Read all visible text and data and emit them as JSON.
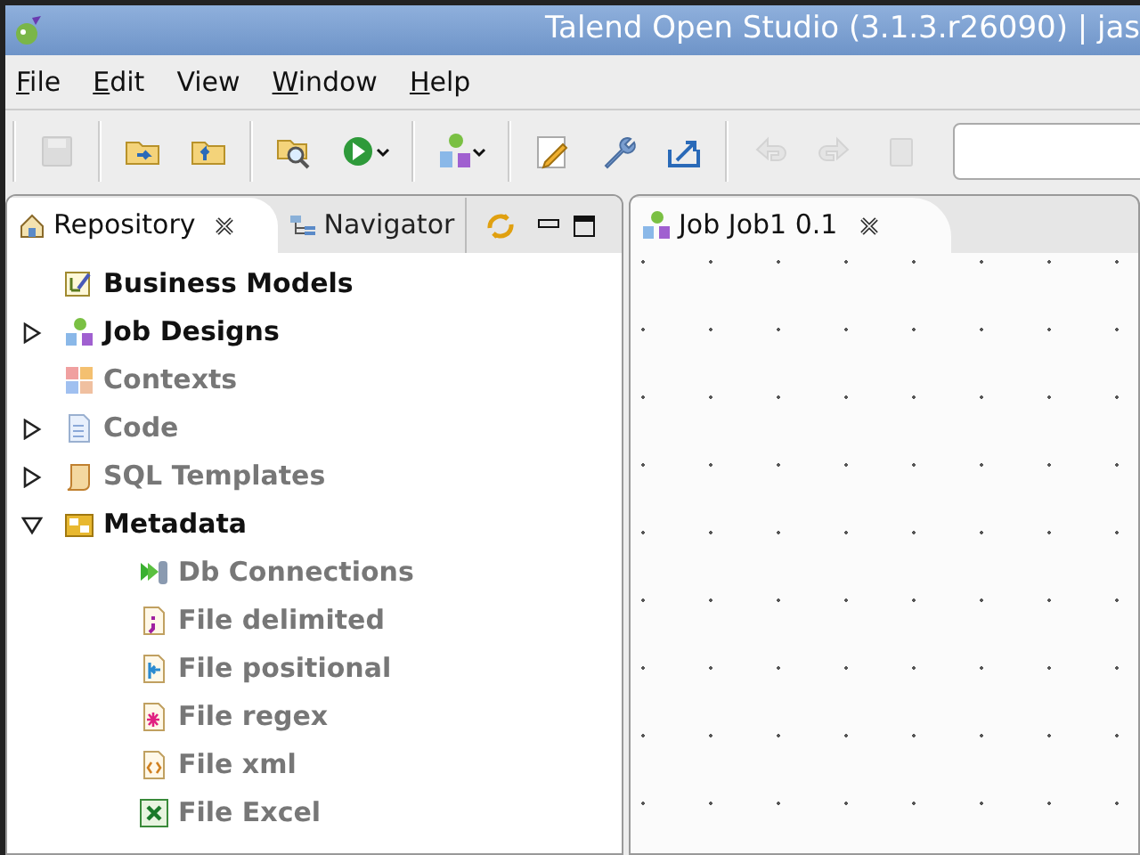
{
  "window": {
    "title": "Talend Open Studio (3.1.3.r26090) | jas"
  },
  "menu": [
    {
      "label": "File",
      "mnemonic": true
    },
    {
      "label": "Edit",
      "mnemonic": true
    },
    {
      "label": "View",
      "mnemonic": false
    },
    {
      "label": "Window",
      "mnemonic": true
    },
    {
      "label": "Help",
      "mnemonic": true
    }
  ],
  "toolbar": [
    {
      "kind": "save",
      "disabled": true
    },
    {
      "kind": "sep"
    },
    {
      "kind": "import",
      "disabled": false
    },
    {
      "kind": "export",
      "disabled": false
    },
    {
      "kind": "sep"
    },
    {
      "kind": "find",
      "disabled": false
    },
    {
      "kind": "run",
      "disabled": false
    },
    {
      "kind": "sep"
    },
    {
      "kind": "job",
      "disabled": false
    },
    {
      "kind": "sep"
    },
    {
      "kind": "edit",
      "disabled": false
    },
    {
      "kind": "wrench",
      "disabled": false
    },
    {
      "kind": "share",
      "disabled": false
    },
    {
      "kind": "sep"
    },
    {
      "kind": "undo",
      "disabled": true
    },
    {
      "kind": "redo",
      "disabled": true
    },
    {
      "kind": "clip",
      "disabled": true
    }
  ],
  "left_panel": {
    "tabs": [
      {
        "label": "Repository",
        "selected": true
      },
      {
        "label": "Navigator",
        "selected": false
      }
    ],
    "tree": [
      {
        "label": "Business Models",
        "kind": "model",
        "disabled": false
      },
      {
        "label": "Job Designs",
        "kind": "job",
        "disabled": false,
        "expanded": false
      },
      {
        "label": "Contexts",
        "kind": "context",
        "disabled": true
      },
      {
        "label": "Code",
        "kind": "code",
        "disabled": true,
        "expanded": false
      },
      {
        "label": "SQL Templates",
        "kind": "scroll",
        "disabled": true,
        "expanded": false
      },
      {
        "label": "Metadata",
        "kind": "metadata",
        "disabled": false,
        "expanded": true,
        "children": [
          {
            "label": "Db Connections",
            "kind": "db",
            "disabled": true
          },
          {
            "label": "File delimited",
            "kind": "delimited",
            "disabled": true
          },
          {
            "label": "File positional",
            "kind": "positional",
            "disabled": true
          },
          {
            "label": "File regex",
            "kind": "regex",
            "disabled": true
          },
          {
            "label": "File xml",
            "kind": "xml",
            "disabled": true
          },
          {
            "label": "File Excel",
            "kind": "excel",
            "disabled": true
          }
        ]
      }
    ]
  },
  "editor": {
    "tabs": [
      {
        "label": "Job Job1 0.1",
        "selected": true
      }
    ]
  }
}
